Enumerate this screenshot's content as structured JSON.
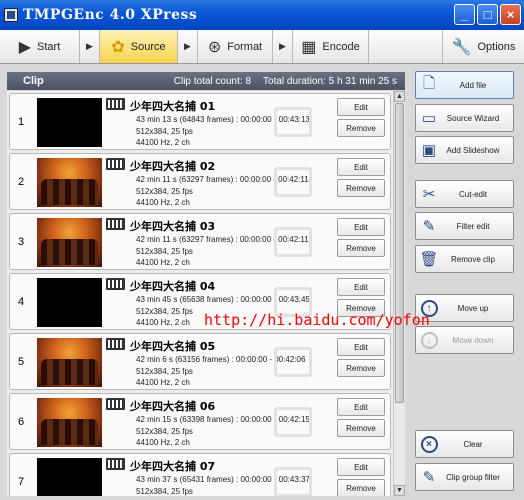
{
  "window": {
    "title": "TMPGEnc 4.0 XPress",
    "controls": {
      "minimize": "_",
      "maximize": "□",
      "close": "×"
    }
  },
  "toolbar": {
    "start": "Start",
    "source": "Source",
    "format": "Format",
    "encode": "Encode",
    "options": "Options",
    "arrow": "▶"
  },
  "clip_panel": {
    "title": "Clip",
    "total_count": "Clip total count: 8",
    "total_duration": "Total duration: 5 h 31 min 25 s",
    "edit_label": "Edit",
    "remove_label": "Remove",
    "clips": [
      {
        "num": "1",
        "name": "少年四大名捕 01",
        "duration": "43 min 13 s (64843 frames) : 00:00:00 - 00:43:13",
        "video": "512x384,  25 fps",
        "audio": "44100  Hz,  2 ch",
        "thumbnail": "black"
      },
      {
        "num": "2",
        "name": "少年四大名捕 02",
        "duration": "42 min 11 s (63297 frames) : 00:00:00 - 00:42:11",
        "video": "512x384,  25 fps",
        "audio": "44100  Hz,  2 ch",
        "thumbnail": "scene"
      },
      {
        "num": "3",
        "name": "少年四大名捕 03",
        "duration": "42 min 11 s (63297 frames) : 00:00:00 - 00:42:11",
        "video": "512x384,  25 fps",
        "audio": "44100  Hz,  2 ch",
        "thumbnail": "scene"
      },
      {
        "num": "4",
        "name": "少年四大名捕 04",
        "duration": "43 min 45 s (65638 frames) : 00:00:00 - 00:43:45",
        "video": "512x384,  25 fps",
        "audio": "44100  Hz,  2 ch",
        "thumbnail": "black"
      },
      {
        "num": "5",
        "name": "少年四大名捕 05",
        "duration": "42 min 6 s (63156 frames) : 00:00:00 - 00:42:06",
        "video": "512x384,  25 fps",
        "audio": "44100  Hz,  2 ch",
        "thumbnail": "scene"
      },
      {
        "num": "6",
        "name": "少年四大名捕 06",
        "duration": "42 min 15 s (63398 frames) : 00:00:00 - 00:42:15",
        "video": "512x384,  25 fps",
        "audio": "44100  Hz,  2 ch",
        "thumbnail": "scene"
      },
      {
        "num": "7",
        "name": "少年四大名捕 07",
        "duration": "43 min 37 s (65431 frames) : 00:00:00 - 00:43:37",
        "video": "512x384,  25 fps",
        "audio": "",
        "thumbnail": "black"
      }
    ]
  },
  "side_panel": {
    "add_file": "Add file",
    "source_wizard": "Source Wizard",
    "add_slideshow": "Add Slideshow",
    "cut_edit": "Cut-edit",
    "filter_edit": "Filter edit",
    "remove_clip": "Remove clip",
    "move_up": "Move up",
    "move_down": "Move down",
    "clear": "Clear",
    "clip_group_filter": "Clip group filter"
  },
  "watermark": "http://hi.baidu.com/yofon"
}
